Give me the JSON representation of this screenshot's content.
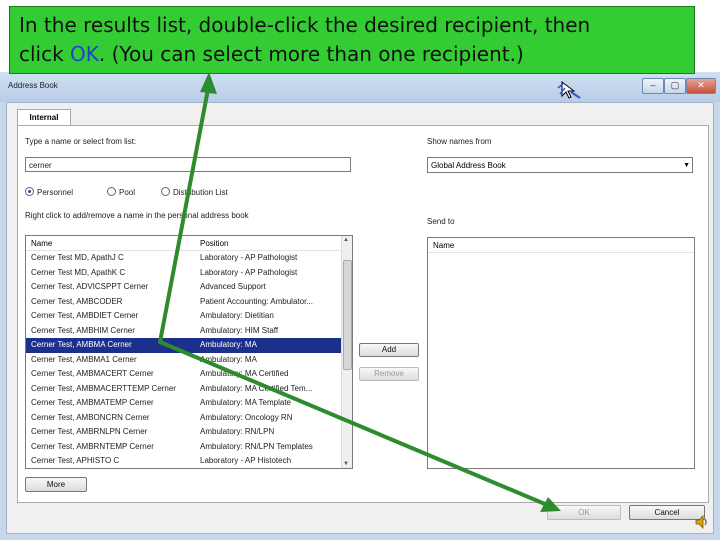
{
  "banner": {
    "line1": "In the results list, double-click the desired recipient, then",
    "line2_pre": "click ",
    "line2_ok": "OK",
    "line2_post": ". (You can select more than one recipient.)"
  },
  "window": {
    "title": "Address Book",
    "minimize": "–",
    "maximize": "▢",
    "close": "✕"
  },
  "tab": {
    "label": "Internal"
  },
  "search": {
    "label": "Type a name or select from list:",
    "value": "cerner"
  },
  "show_names": {
    "label": "Show names from",
    "selected": "Global Address Book",
    "arrow": "▼"
  },
  "types": [
    {
      "label": "Personnel",
      "checked": true
    },
    {
      "label": "Pool",
      "checked": false
    },
    {
      "label": "Distribution List",
      "checked": false
    }
  ],
  "hint": "Right click to add/remove a name in the personal address book",
  "results": {
    "columns": [
      "Name",
      "Position"
    ],
    "rows": [
      {
        "name": "Cerner Test MD, ApathJ C",
        "position": "Laboratory - AP Pathologist"
      },
      {
        "name": "Cerner Test MD, ApathK C",
        "position": "Laboratory - AP Pathologist"
      },
      {
        "name": "Cerner Test, ADVICSPPT Cerner",
        "position": "Advanced Support"
      },
      {
        "name": "Cerner Test, AMBCODER",
        "position": "Patient Accounting: Ambulator..."
      },
      {
        "name": "Cerner Test, AMBDIET Cerner",
        "position": "Ambulatory: Dietitian"
      },
      {
        "name": "Cerner Test, AMBHIM Cerner",
        "position": "Ambulatory: HIM Staff"
      },
      {
        "name": "Cerner Test, AMBMA Cerner",
        "position": "Ambulatory: MA"
      },
      {
        "name": "Cerner Test, AMBMA1 Cerner",
        "position": "Ambulatory: MA"
      },
      {
        "name": "Cerner Test, AMBMACERT Cerner",
        "position": "Ambulatory: MA Certified"
      },
      {
        "name": "Cerner Test, AMBMACERTTEMP Cerner",
        "position": "Ambulatory: MA Certified Tem..."
      },
      {
        "name": "Cerner Test, AMBMATEMP Cerner",
        "position": "Ambulatory: MA Template"
      },
      {
        "name": "Cerner Test, AMBONCRN Cerner",
        "position": "Ambulatory: Oncology RN"
      },
      {
        "name": "Cerner Test, AMBRNLPN Cerner",
        "position": "Ambulatory: RN/LPN"
      },
      {
        "name": "Cerner Test, AMBRNTEMP Cerner",
        "position": "Ambulatory: RN/LPN Templates"
      },
      {
        "name": "Cerner Test, APHISTO C",
        "position": "Laboratory - AP Histotech"
      }
    ],
    "selected_name": "Cerner Test, AMBMA Cerner"
  },
  "buttons": {
    "add": "Add",
    "remove": "Remove",
    "more": "More",
    "ok": "OK",
    "cancel": "Cancel"
  },
  "send_to": {
    "label": "Send to",
    "column": "Name"
  },
  "colors": {
    "banner": "#33cc33",
    "arrows": "#2e8b2e",
    "selection": "#1b2f8c",
    "ok_text": "#2244cc"
  },
  "icons": [
    "cursor-icon",
    "speaker-icon"
  ]
}
